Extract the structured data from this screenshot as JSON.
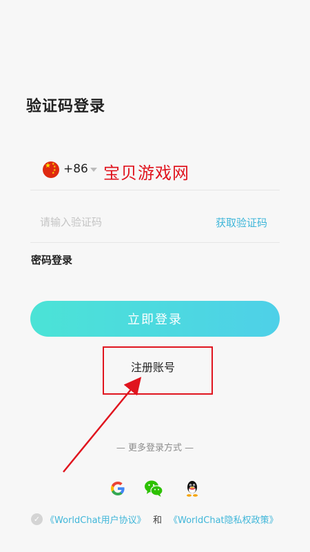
{
  "page": {
    "title": "验证码登录"
  },
  "phone": {
    "country_code": "+86",
    "watermark": "宝贝游戏网"
  },
  "code": {
    "placeholder": "请输入验证码",
    "value": "",
    "get_code_label": "获取验证码"
  },
  "password_login_label": "密码登录",
  "login_button_label": "立即登录",
  "register_label": "注册账号",
  "more_login_label": "— 更多登录方式 —",
  "social": [
    {
      "name": "google",
      "icon": "google-icon"
    },
    {
      "name": "wechat",
      "icon": "wechat-icon"
    },
    {
      "name": "qq",
      "icon": "qq-icon"
    }
  ],
  "agreement": {
    "terms_label": "《WorldChat用户协议》",
    "and_label": "和",
    "privacy_label": "《WorldChat隐私权政策》"
  },
  "colors": {
    "accent": "#3fb6d9",
    "button_start": "#4be3d6",
    "button_end": "#4ed0e8",
    "annotation_red": "#e0141e"
  }
}
